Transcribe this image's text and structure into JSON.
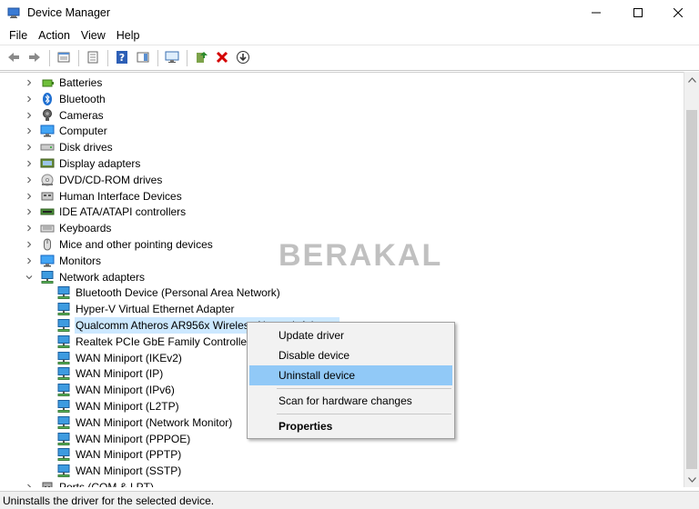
{
  "window": {
    "title": "Device Manager",
    "controls": [
      "minimize",
      "maximize",
      "close"
    ]
  },
  "menubar": {
    "items": [
      "File",
      "Action",
      "View",
      "Help"
    ]
  },
  "toolbar": {
    "buttons": [
      "back-icon",
      "forward-icon",
      "properties-icon",
      "show-hide-icon",
      "help-icon",
      "action-pane-icon",
      "monitor-icon",
      "update-driver-icon",
      "uninstall-icon",
      "download-icon"
    ]
  },
  "tree": {
    "categories": [
      {
        "label": "Batteries",
        "icon": "battery-icon"
      },
      {
        "label": "Bluetooth",
        "icon": "bluetooth-icon"
      },
      {
        "label": "Cameras",
        "icon": "camera-icon"
      },
      {
        "label": "Computer",
        "icon": "computer-icon"
      },
      {
        "label": "Disk drives",
        "icon": "disk-drive-icon"
      },
      {
        "label": "Display adapters",
        "icon": "display-adapter-icon"
      },
      {
        "label": "DVD/CD-ROM drives",
        "icon": "dvd-icon"
      },
      {
        "label": "Human Interface Devices",
        "icon": "hid-icon"
      },
      {
        "label": "IDE ATA/ATAPI controllers",
        "icon": "ide-icon"
      },
      {
        "label": "Keyboards",
        "icon": "keyboard-icon"
      },
      {
        "label": "Mice and other pointing devices",
        "icon": "mouse-icon"
      },
      {
        "label": "Monitors",
        "icon": "monitor-icon"
      },
      {
        "label": "Network adapters",
        "icon": "network-adapter-icon",
        "expanded": true
      }
    ],
    "network_adapters": [
      "Bluetooth Device (Personal Area Network)",
      "Hyper-V Virtual Ethernet Adapter",
      "Qualcomm Atheros AR956x Wireless Network Adapter",
      "Realtek PCIe GbE Family Controller",
      "WAN Miniport (IKEv2)",
      "WAN Miniport (IP)",
      "WAN Miniport (IPv6)",
      "WAN Miniport (L2TP)",
      "WAN Miniport (Network Monitor)",
      "WAN Miniport (PPPOE)",
      "WAN Miniport (PPTP)",
      "WAN Miniport (SSTP)"
    ],
    "selected_index": 2,
    "after": {
      "label": "Ports (COM & LPT)",
      "icon": "port-icon"
    }
  },
  "context_menu": {
    "update_driver": "Update driver",
    "disable_device": "Disable device",
    "uninstall_device": "Uninstall device",
    "scan_hardware": "Scan for hardware changes",
    "properties": "Properties",
    "highlighted": "Uninstall device"
  },
  "watermark": "BERAKAL",
  "statusbar": {
    "text": "Uninstalls the driver for the selected device."
  },
  "colors": {
    "selection": "#cce8ff",
    "menu_highlight": "#91c9f7",
    "network_icon": "#2b8fd6"
  }
}
